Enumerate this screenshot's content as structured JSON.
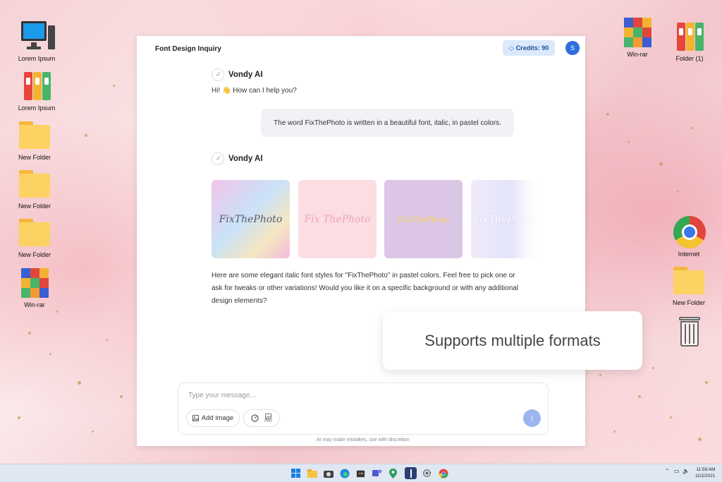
{
  "desktop": {
    "left_icons": [
      {
        "label": "Lorem Ipsum",
        "icon": "computer-icon"
      },
      {
        "label": "Lorem Ipsum",
        "icon": "binders-icon"
      },
      {
        "label": "New Folder",
        "icon": "folder-icon"
      },
      {
        "label": "New Folder",
        "icon": "folder-icon"
      },
      {
        "label": "New Folder",
        "icon": "folder-icon"
      },
      {
        "label": "Win-rar",
        "icon": "winrar-icon"
      }
    ],
    "right_icons": [
      {
        "label": "Win-rar",
        "icon": "winrar-icon"
      },
      {
        "label": "Folder (1)",
        "icon": "binders-icon"
      },
      {
        "label": "Internet",
        "icon": "chrome-icon"
      },
      {
        "label": "New Folder",
        "icon": "folder-icon"
      },
      {
        "label": "",
        "icon": "recycle-bin-icon"
      }
    ]
  },
  "window": {
    "title": "Font Design Inquiry",
    "credits_label": "Credits: 90",
    "avatar_initial": "S"
  },
  "chat": {
    "bot_name": "Vondy AI",
    "greeting": "Hi! 👋 How can I help you?",
    "user_message": "The word FixThePhoto is written in a beautiful font, italic, in pastel colors.",
    "images": [
      {
        "text": "FixThePhoto"
      },
      {
        "text": "Fix ThePhoto"
      },
      {
        "text": "FixThePhoto"
      },
      {
        "text": "FixThePhoto"
      }
    ],
    "answer": "Here are some elegant italic font styles for \"FixThePhoto\" in pastel colors. Feel free to pick one or ask for tweaks or other variations! Would you like it on a specific background or with any additional design elements?"
  },
  "composer": {
    "placeholder": "Type your message...",
    "add_image_label": "Add image",
    "pro_label": "PRO",
    "disclaimer": "AI may make mistakes, use with discretion"
  },
  "overlay": {
    "text": "Supports multiple formats"
  },
  "taskbar": {
    "time": "11:59 AM",
    "date": "11/2/2021"
  },
  "colors": {
    "accent": "#2f6fdd",
    "credits_bg": "#dbe9fb",
    "send_button": "#9bb6ef"
  }
}
